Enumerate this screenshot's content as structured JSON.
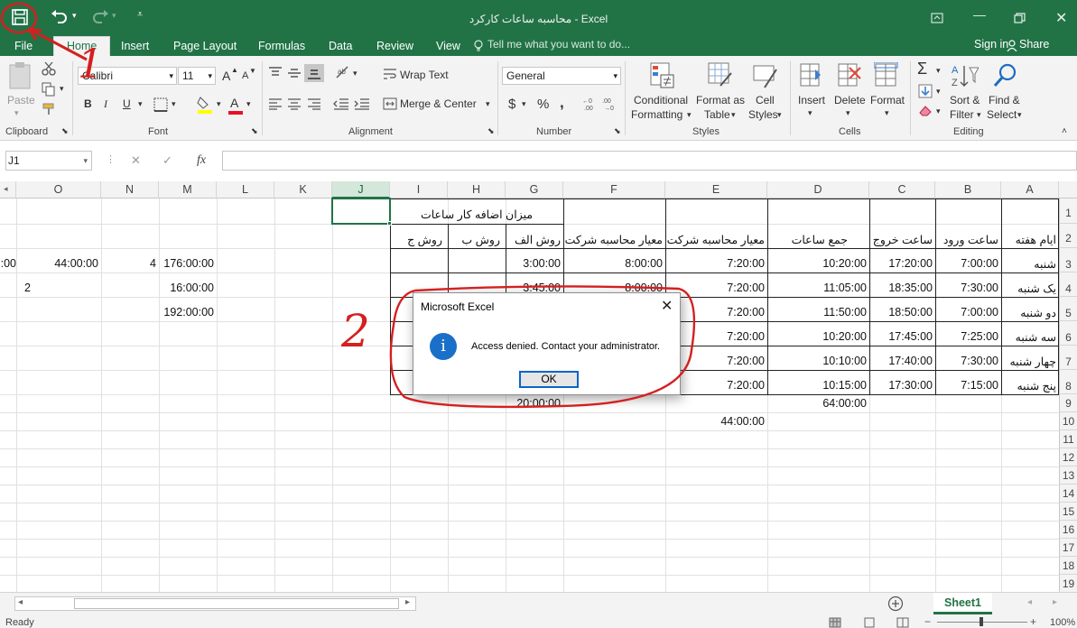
{
  "window": {
    "title": "محاسبه ساعات کارکرد - Excel",
    "qat": {
      "save_icon": "save-icon",
      "undo_icon": "undo-icon",
      "redo_icon": "redo-icon",
      "customize_icon": "customize-icon"
    }
  },
  "tabs": [
    {
      "label": "File"
    },
    {
      "label": "Home"
    },
    {
      "label": "Insert"
    },
    {
      "label": "Page Layout"
    },
    {
      "label": "Formulas"
    },
    {
      "label": "Data"
    },
    {
      "label": "Review"
    },
    {
      "label": "View"
    }
  ],
  "tell_me": "Tell me what you want to do...",
  "sign_in": "Sign in",
  "share": "Share",
  "ribbon": {
    "clipboard": {
      "label": "Clipboard",
      "paste": "Paste"
    },
    "font": {
      "label": "Font",
      "name": "Calibri",
      "size": "11",
      "bold": "B",
      "italic": "I",
      "underline": "U",
      "grow": "A",
      "shrink": "A"
    },
    "alignment": {
      "label": "Alignment",
      "wrap": "Wrap Text",
      "merge": "Merge & Center"
    },
    "number": {
      "label": "Number",
      "format": "General",
      "currency": "$",
      "percent": "%",
      "comma": ","
    },
    "styles": {
      "label": "Styles",
      "conditional": "Conditional",
      "formatting": "Formatting",
      "format_as": "Format as",
      "table": "Table",
      "cell": "Cell",
      "cell_styles": "Styles"
    },
    "cells": {
      "label": "Cells",
      "insert": "Insert",
      "delete": "Delete",
      "format": "Format"
    },
    "editing": {
      "label": "Editing",
      "sort": "Sort &",
      "filter": "Filter",
      "find": "Find &",
      "select": "Select"
    }
  },
  "formula_bar": {
    "name_box": "J1",
    "fx": "fx",
    "cancel": "✕",
    "enter": "✓",
    "value": ""
  },
  "columns": [
    "A",
    "B",
    "C",
    "D",
    "E",
    "F",
    "G",
    "H",
    "I",
    "J",
    "K",
    "L",
    "M",
    "N",
    "O"
  ],
  "rows": [
    "1",
    "2",
    "3",
    "4",
    "5",
    "6",
    "7",
    "8",
    "9",
    "10",
    "11",
    "12",
    "13",
    "14",
    "15",
    "16",
    "17",
    "18",
    "19"
  ],
  "cells": {
    "A2": "ایام هفته",
    "B2": "ساعت ورود",
    "C2": "ساعت خروج",
    "D2": "جمع ساعات",
    "E2": "معیار محاسبه شرکت",
    "F2": "معیار محاسبه شرکت",
    "G1": "میزان اضافه کار ساعات",
    "G2": "روش الف",
    "H2": "روش ب",
    "I2": "روش ج",
    "A3": "شنبه",
    "B3": "7:00:00",
    "C3": "17:20:00",
    "D3": "10:20:00",
    "E3": "7:20:00",
    "F3": "8:00:00",
    "G3": "3:00:00",
    "A4": "یک شنبه",
    "B4": "7:30:00",
    "C4": "18:35:00",
    "D4": "11:05:00",
    "E4": "7:20:00",
    "F4": "8:00:00",
    "G4": "3:45:00",
    "A5": "دو شنبه",
    "B5": "7:00:00",
    "C5": "18:50:00",
    "D5": "11:50:00",
    "E5": "7:20:00",
    "A6": "سه شنبه",
    "B6": "7:25:00",
    "C6": "17:45:00",
    "D6": "10:20:00",
    "E6": "7:20:00",
    "A7": "چهار شنبه",
    "B7": "7:30:00",
    "C7": "17:40:00",
    "D7": "10:10:00",
    "E7": "7:20:00",
    "A8": "پنج شنبه",
    "B8": "7:15:00",
    "C8": "17:30:00",
    "D8": "10:15:00",
    "E8": "7:20:00",
    "D9": "64:00:00",
    "G9": "20:00:00",
    "E10": "44:00:00",
    "M3": "176:00:00",
    "N3": "4",
    "O3": "44:00:00",
    "P3": ":00",
    "M4": "16:00:00",
    "P4": "2",
    "M5": "192:00:00"
  },
  "sheet_tab": "Sheet1",
  "status": "Ready",
  "zoom": "100%",
  "dialog": {
    "title": "Microsoft Excel",
    "message": "Access denied. Contact your administrator.",
    "ok": "OK",
    "icon": "info-icon"
  },
  "annotations": {
    "one": "1",
    "two": "2",
    "color": "#d42020"
  }
}
